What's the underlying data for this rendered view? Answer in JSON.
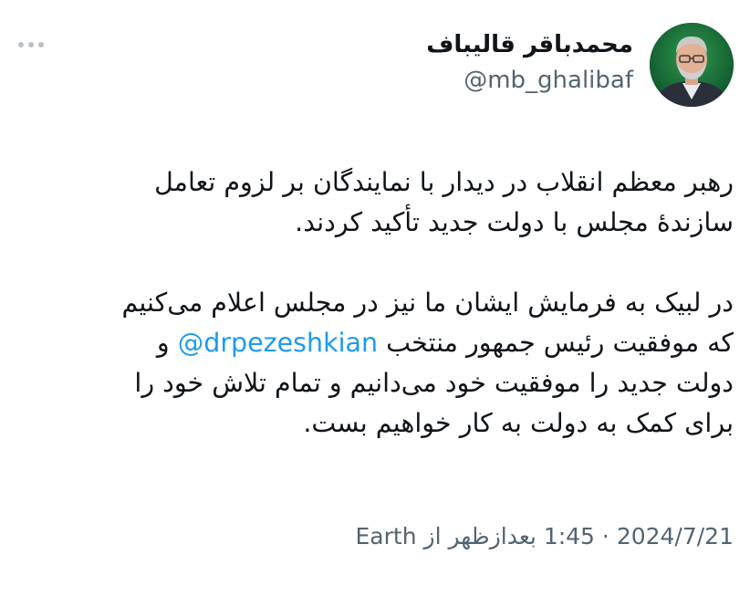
{
  "author": {
    "name": "محمدباقر قالیباف",
    "handle": "@mb_ghalibaf"
  },
  "tweet": {
    "lines_p1": [
      "رهبر معظم انقلاب در دیدار با نمایندگان بر لزوم تعامل",
      "سازندهٔ مجلس با دولت جدید تأکید کردند."
    ],
    "p2_line1": "در لبیک به فرمایش ایشان ما نیز در مجلس اعلام می‌کنیم",
    "p2_line2_pre": "که موفقیت رئیس جمهور منتخب",
    "mention": "@drpezeshkian",
    "p2_line2_post": "و",
    "p2_line3": "دولت جدید را موفقیت خود می‌دانیم و تمام تلاش خود را",
    "p2_line4": "برای کمک به دولت به کار خواهیم بست."
  },
  "meta": {
    "date": "2024/7/21",
    "separator": "·",
    "time": "1:45 بعدازظهر",
    "from": "از",
    "source": "Earth"
  },
  "icons": {
    "more": "more-dots-icon",
    "avatar": "profile-photo"
  },
  "colors": {
    "accent": "#1d9bf0",
    "secondary_text": "#536471",
    "primary_text": "#0f1419"
  }
}
